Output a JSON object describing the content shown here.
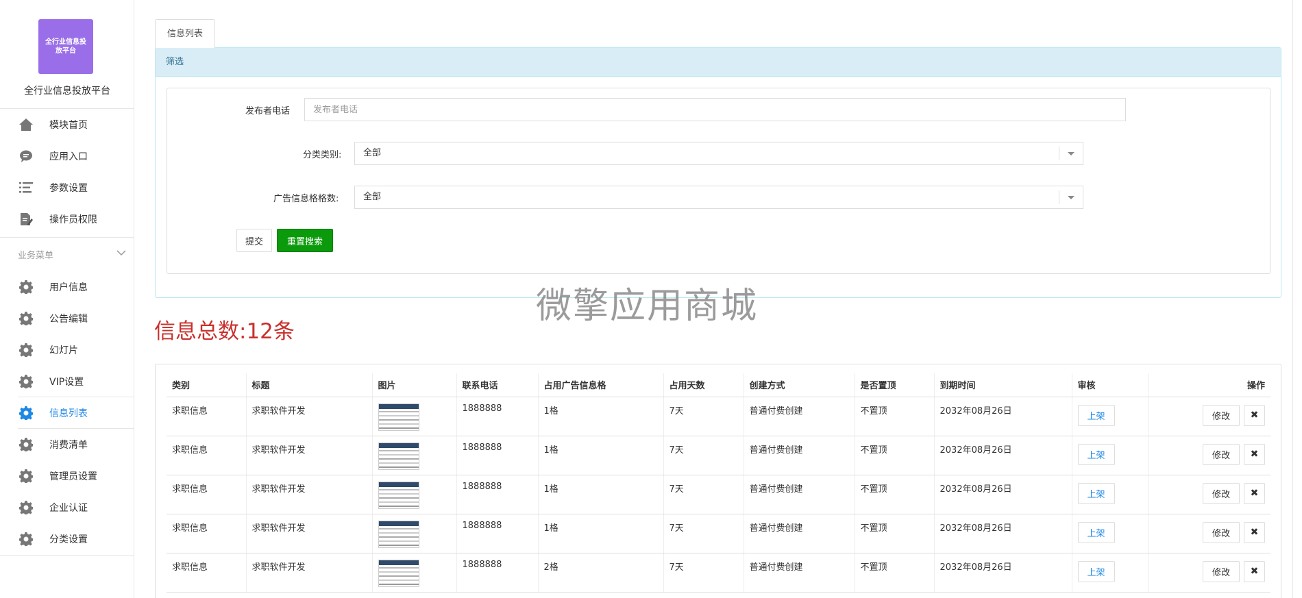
{
  "sidebar": {
    "logo_text": "全行业信息投放平台",
    "app_name": "全行业信息投放平台",
    "top_items": [
      {
        "label": "模块首页",
        "icon": "home-icon"
      },
      {
        "label": "应用入口",
        "icon": "chat-icon"
      },
      {
        "label": "参数设置",
        "icon": "list-icon"
      },
      {
        "label": "操作员权限",
        "icon": "edit-doc-icon"
      }
    ],
    "section_label": "业务菜单",
    "business_items": [
      {
        "label": "用户信息",
        "icon": "gear-icon"
      },
      {
        "label": "公告编辑",
        "icon": "gear-icon"
      },
      {
        "label": "幻灯片",
        "icon": "gear-icon"
      },
      {
        "label": "VIP设置",
        "icon": "gear-icon"
      },
      {
        "label": "信息列表",
        "icon": "gear-icon",
        "active": true
      },
      {
        "label": "消费清单",
        "icon": "gear-icon"
      },
      {
        "label": "管理员设置",
        "icon": "gear-icon"
      },
      {
        "label": "企业认证",
        "icon": "gear-icon"
      },
      {
        "label": "分类设置",
        "icon": "gear-icon"
      }
    ]
  },
  "tab": {
    "label": "信息列表"
  },
  "filter": {
    "heading": "筛选",
    "phone_label": "发布者电话",
    "phone_placeholder": "发布者电话",
    "category_label": "分类类别:",
    "category_value": "全部",
    "slots_label": "广告信息格格数:",
    "slots_value": "全部",
    "submit_label": "提交",
    "reset_label": "重置搜索"
  },
  "watermark": "微擎应用商城",
  "total_text": "信息总数:12条",
  "table": {
    "headers": [
      "类别",
      "标题",
      "图片",
      "联系电话",
      "占用广告信息格",
      "占用天数",
      "创建方式",
      "是否置顶",
      "到期时间",
      "审核",
      "操作"
    ],
    "rows": [
      {
        "category": "求职信息",
        "title": "求职软件开发",
        "phone": "1888888",
        "slots": "1格",
        "days": "7天",
        "method": "普通付费创建",
        "top": "不置顶",
        "expire": "2032年08月26日",
        "review": "上架",
        "edit": "修改",
        "delete": "✖"
      },
      {
        "category": "求职信息",
        "title": "求职软件开发",
        "phone": "1888888",
        "slots": "1格",
        "days": "7天",
        "method": "普通付费创建",
        "top": "不置顶",
        "expire": "2032年08月26日",
        "review": "上架",
        "edit": "修改",
        "delete": "✖"
      },
      {
        "category": "求职信息",
        "title": "求职软件开发",
        "phone": "1888888",
        "slots": "1格",
        "days": "7天",
        "method": "普通付费创建",
        "top": "不置顶",
        "expire": "2032年08月26日",
        "review": "上架",
        "edit": "修改",
        "delete": "✖"
      },
      {
        "category": "求职信息",
        "title": "求职软件开发",
        "phone": "1888888",
        "slots": "1格",
        "days": "7天",
        "method": "普通付费创建",
        "top": "不置顶",
        "expire": "2032年08月26日",
        "review": "上架",
        "edit": "修改",
        "delete": "✖"
      },
      {
        "category": "求职信息",
        "title": "求职软件开发",
        "phone": "1888888",
        "slots": "2格",
        "days": "7天",
        "method": "普通付费创建",
        "top": "不置顶",
        "expire": "2032年08月26日",
        "review": "上架",
        "edit": "修改",
        "delete": "✖"
      }
    ]
  },
  "colors": {
    "accent": "#1e88e5",
    "logo": "#9a6ee8",
    "reset_button": "#0b9a0b",
    "total_text": "#c9302c",
    "panel_head": "#d9edf7"
  }
}
